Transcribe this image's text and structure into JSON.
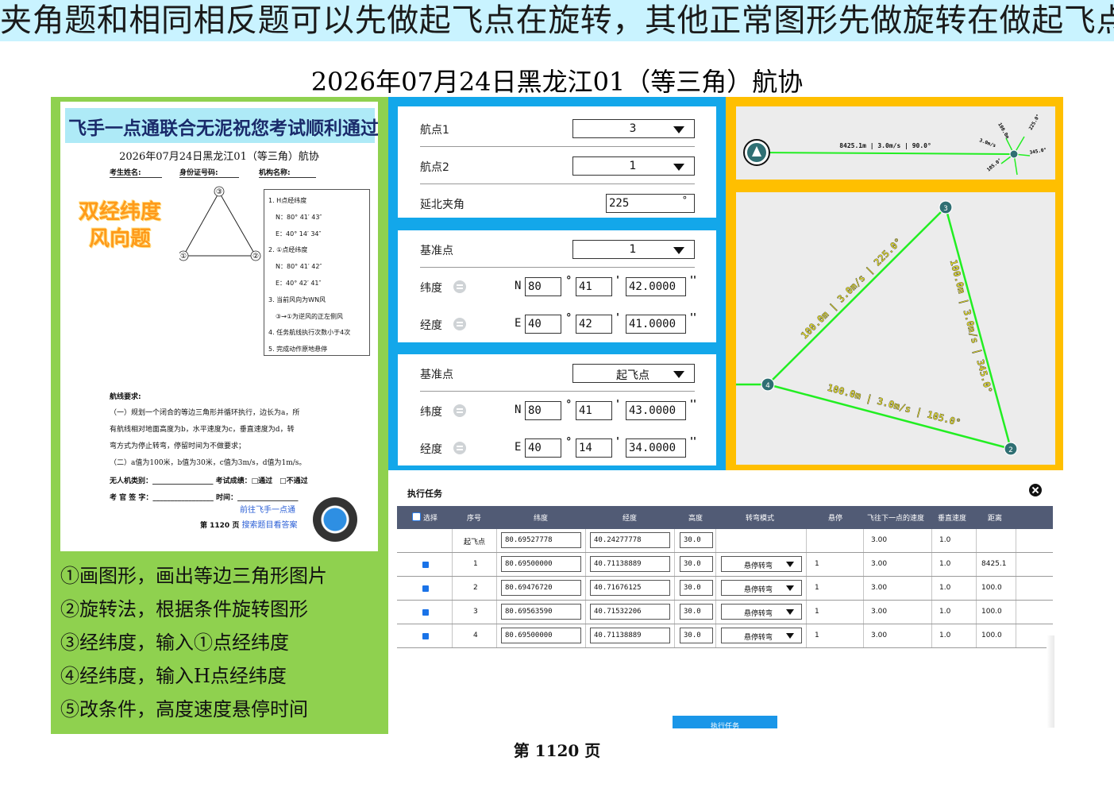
{
  "banner": "夹角题和相同相反题可以先做起飞点在旋转，其他正常图形先做旋转在做起飞点",
  "title": "2026年07月24日黑龙江01（等三角）航协",
  "footer": "第 1120 页",
  "paper": {
    "banner": "飞手一点通联合无泥祝您考试顺利通过",
    "title": "2026年07月24日黑龙江01（等三角）航协",
    "fields": [
      "考生姓名:",
      "身份证号码:",
      "机构名称:"
    ],
    "stamp_line1": "双经纬度",
    "stamp_line2": "风向题",
    "triangle_labels": [
      "③",
      "①",
      "②"
    ],
    "conditions": [
      "1. H点经纬度",
      "N：80° 41′ 43″",
      "E：40° 14′ 34″",
      "2. ①点经纬度",
      "N：80° 41′ 42″",
      "E：40° 42′ 41″",
      "3. 当前风向为WN风",
      "③→①为逆风的正左侧风",
      "4. 任务航线执行次数小于4次",
      "5. 完成动作原地悬停"
    ],
    "route_head": "航线要求:",
    "route_text": [
      "（一）规划一个闭合的等边三角形并循环执行，边长为a，所",
      "有航线相对地面高度为b，水平速度为c，垂直速度为d，转",
      "弯方式为停止转弯，停留时间为不做要求；",
      "（二）a值为100米，b值为30米，c值为3m/s，d值为1m/s。"
    ],
    "sign1": "无人机类别：_________________ 考试成绩：□通过　□不通过",
    "sign2": "考 官 签 字：_________________ 时间：_________________",
    "qr_text1": "前往飞手一点通",
    "qr_text2": "搜索题目看答案",
    "qr_page": "第 1120 页"
  },
  "steps": [
    "①画图形，画出等边三角形图片",
    "②旋转法，根据条件旋转图形",
    "③经纬度，输入①点经纬度",
    "④经纬度，输入H点经纬度",
    "⑤改条件，高度速度悬停时间"
  ],
  "form": {
    "box1": {
      "waypoint1_label": "航点1",
      "waypoint1_value": "3",
      "waypoint2_label": "航点2",
      "waypoint2_value": "1",
      "angle_label": "延北夹角",
      "angle_value": "225",
      "angle_unit": "°"
    },
    "box2": {
      "ref_label": "基准点",
      "ref_value": "1",
      "lat_label": "纬度",
      "lat_hemi": "N",
      "lat_d": "80",
      "lat_m": "41",
      "lat_s": "42.0000",
      "lon_label": "经度",
      "lon_hemi": "E",
      "lon_d": "40",
      "lon_m": "42",
      "lon_s": "41.0000"
    },
    "box3": {
      "ref_label": "基准点",
      "ref_value": "起飞点",
      "lat_label": "纬度",
      "lat_hemi": "N",
      "lat_d": "80",
      "lat_m": "41",
      "lat_s": "43.0000",
      "lon_label": "经度",
      "lon_hemi": "E",
      "lon_d": "40",
      "lon_m": "14",
      "lon_s": "34.0000"
    },
    "deg_sym": "°",
    "min_sym": "'",
    "sec_sym": "''"
  },
  "map": {
    "top_label": "8425.1m | 3.0m/s | 90.0°",
    "cluster_labels": [
      "100.0m",
      "3.0m/s",
      "225.0°",
      "345.0°",
      "105.0°"
    ],
    "edge_31": "100.0m | 3.0m/s | 225.0°",
    "edge_32": "100.0m | 3.0m/s | 345.0°",
    "edge_12": "100.0m | 3.0m/s | 105.0°",
    "node_labels": {
      "n1": "1",
      "n2": "2",
      "n3": "3",
      "n4": "4"
    },
    "line_color": "#22ee22",
    "node_color": "#2f6f73"
  },
  "task": {
    "title": "执行任务",
    "columns": [
      "选择",
      "序号",
      "纬度",
      "经度",
      "高度",
      "转弯模式",
      "悬停",
      "飞往下一点的速度",
      "垂直速度",
      "距离"
    ],
    "rows": [
      {
        "seq": "起飞点",
        "lat": "80.69527778",
        "lon": "40.24277778",
        "alt": "30.0",
        "turn": "",
        "hover": "",
        "speed": "3.00",
        "vspeed": "1.0",
        "dist": ""
      },
      {
        "seq": "1",
        "lat": "80.69500000",
        "lon": "40.71138889",
        "alt": "30.0",
        "turn": "悬停转弯",
        "hover": "1",
        "speed": "3.00",
        "vspeed": "1.0",
        "dist": "8425.1"
      },
      {
        "seq": "2",
        "lat": "80.69476720",
        "lon": "40.71676125",
        "alt": "30.0",
        "turn": "悬停转弯",
        "hover": "1",
        "speed": "3.00",
        "vspeed": "1.0",
        "dist": "100.0"
      },
      {
        "seq": "3",
        "lat": "80.69563590",
        "lon": "40.71532206",
        "alt": "30.0",
        "turn": "悬停转弯",
        "hover": "1",
        "speed": "3.00",
        "vspeed": "1.0",
        "dist": "100.0"
      },
      {
        "seq": "4",
        "lat": "80.69500000",
        "lon": "40.71138889",
        "alt": "30.0",
        "turn": "悬停转弯",
        "hover": "1",
        "speed": "3.00",
        "vspeed": "1.0",
        "dist": "100.0"
      }
    ],
    "execute_label": "执行任务"
  }
}
